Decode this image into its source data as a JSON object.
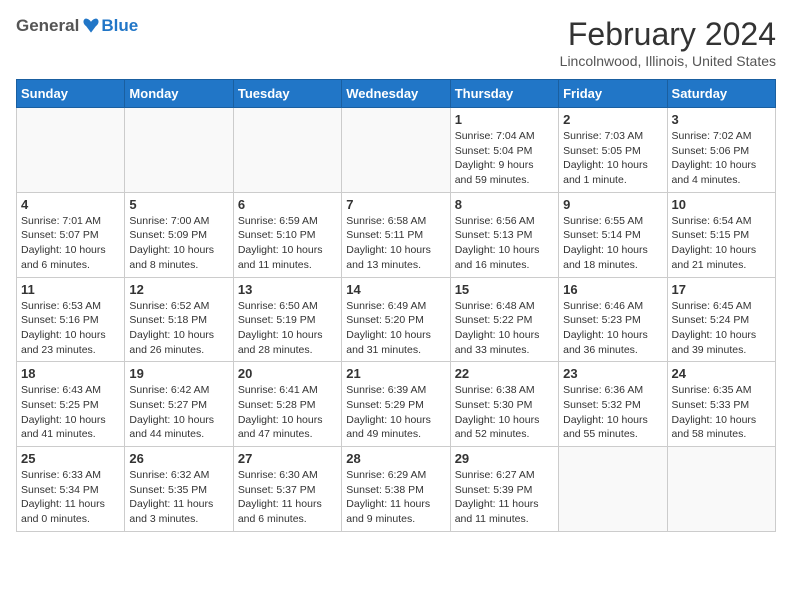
{
  "header": {
    "logo_general": "General",
    "logo_blue": "Blue",
    "month": "February 2024",
    "location": "Lincolnwood, Illinois, United States"
  },
  "weekdays": [
    "Sunday",
    "Monday",
    "Tuesday",
    "Wednesday",
    "Thursday",
    "Friday",
    "Saturday"
  ],
  "weeks": [
    [
      {
        "day": "",
        "info": ""
      },
      {
        "day": "",
        "info": ""
      },
      {
        "day": "",
        "info": ""
      },
      {
        "day": "",
        "info": ""
      },
      {
        "day": "1",
        "info": "Sunrise: 7:04 AM\nSunset: 5:04 PM\nDaylight: 9 hours\nand 59 minutes."
      },
      {
        "day": "2",
        "info": "Sunrise: 7:03 AM\nSunset: 5:05 PM\nDaylight: 10 hours\nand 1 minute."
      },
      {
        "day": "3",
        "info": "Sunrise: 7:02 AM\nSunset: 5:06 PM\nDaylight: 10 hours\nand 4 minutes."
      }
    ],
    [
      {
        "day": "4",
        "info": "Sunrise: 7:01 AM\nSunset: 5:07 PM\nDaylight: 10 hours\nand 6 minutes."
      },
      {
        "day": "5",
        "info": "Sunrise: 7:00 AM\nSunset: 5:09 PM\nDaylight: 10 hours\nand 8 minutes."
      },
      {
        "day": "6",
        "info": "Sunrise: 6:59 AM\nSunset: 5:10 PM\nDaylight: 10 hours\nand 11 minutes."
      },
      {
        "day": "7",
        "info": "Sunrise: 6:58 AM\nSunset: 5:11 PM\nDaylight: 10 hours\nand 13 minutes."
      },
      {
        "day": "8",
        "info": "Sunrise: 6:56 AM\nSunset: 5:13 PM\nDaylight: 10 hours\nand 16 minutes."
      },
      {
        "day": "9",
        "info": "Sunrise: 6:55 AM\nSunset: 5:14 PM\nDaylight: 10 hours\nand 18 minutes."
      },
      {
        "day": "10",
        "info": "Sunrise: 6:54 AM\nSunset: 5:15 PM\nDaylight: 10 hours\nand 21 minutes."
      }
    ],
    [
      {
        "day": "11",
        "info": "Sunrise: 6:53 AM\nSunset: 5:16 PM\nDaylight: 10 hours\nand 23 minutes."
      },
      {
        "day": "12",
        "info": "Sunrise: 6:52 AM\nSunset: 5:18 PM\nDaylight: 10 hours\nand 26 minutes."
      },
      {
        "day": "13",
        "info": "Sunrise: 6:50 AM\nSunset: 5:19 PM\nDaylight: 10 hours\nand 28 minutes."
      },
      {
        "day": "14",
        "info": "Sunrise: 6:49 AM\nSunset: 5:20 PM\nDaylight: 10 hours\nand 31 minutes."
      },
      {
        "day": "15",
        "info": "Sunrise: 6:48 AM\nSunset: 5:22 PM\nDaylight: 10 hours\nand 33 minutes."
      },
      {
        "day": "16",
        "info": "Sunrise: 6:46 AM\nSunset: 5:23 PM\nDaylight: 10 hours\nand 36 minutes."
      },
      {
        "day": "17",
        "info": "Sunrise: 6:45 AM\nSunset: 5:24 PM\nDaylight: 10 hours\nand 39 minutes."
      }
    ],
    [
      {
        "day": "18",
        "info": "Sunrise: 6:43 AM\nSunset: 5:25 PM\nDaylight: 10 hours\nand 41 minutes."
      },
      {
        "day": "19",
        "info": "Sunrise: 6:42 AM\nSunset: 5:27 PM\nDaylight: 10 hours\nand 44 minutes."
      },
      {
        "day": "20",
        "info": "Sunrise: 6:41 AM\nSunset: 5:28 PM\nDaylight: 10 hours\nand 47 minutes."
      },
      {
        "day": "21",
        "info": "Sunrise: 6:39 AM\nSunset: 5:29 PM\nDaylight: 10 hours\nand 49 minutes."
      },
      {
        "day": "22",
        "info": "Sunrise: 6:38 AM\nSunset: 5:30 PM\nDaylight: 10 hours\nand 52 minutes."
      },
      {
        "day": "23",
        "info": "Sunrise: 6:36 AM\nSunset: 5:32 PM\nDaylight: 10 hours\nand 55 minutes."
      },
      {
        "day": "24",
        "info": "Sunrise: 6:35 AM\nSunset: 5:33 PM\nDaylight: 10 hours\nand 58 minutes."
      }
    ],
    [
      {
        "day": "25",
        "info": "Sunrise: 6:33 AM\nSunset: 5:34 PM\nDaylight: 11 hours\nand 0 minutes."
      },
      {
        "day": "26",
        "info": "Sunrise: 6:32 AM\nSunset: 5:35 PM\nDaylight: 11 hours\nand 3 minutes."
      },
      {
        "day": "27",
        "info": "Sunrise: 6:30 AM\nSunset: 5:37 PM\nDaylight: 11 hours\nand 6 minutes."
      },
      {
        "day": "28",
        "info": "Sunrise: 6:29 AM\nSunset: 5:38 PM\nDaylight: 11 hours\nand 9 minutes."
      },
      {
        "day": "29",
        "info": "Sunrise: 6:27 AM\nSunset: 5:39 PM\nDaylight: 11 hours\nand 11 minutes."
      },
      {
        "day": "",
        "info": ""
      },
      {
        "day": "",
        "info": ""
      }
    ]
  ]
}
